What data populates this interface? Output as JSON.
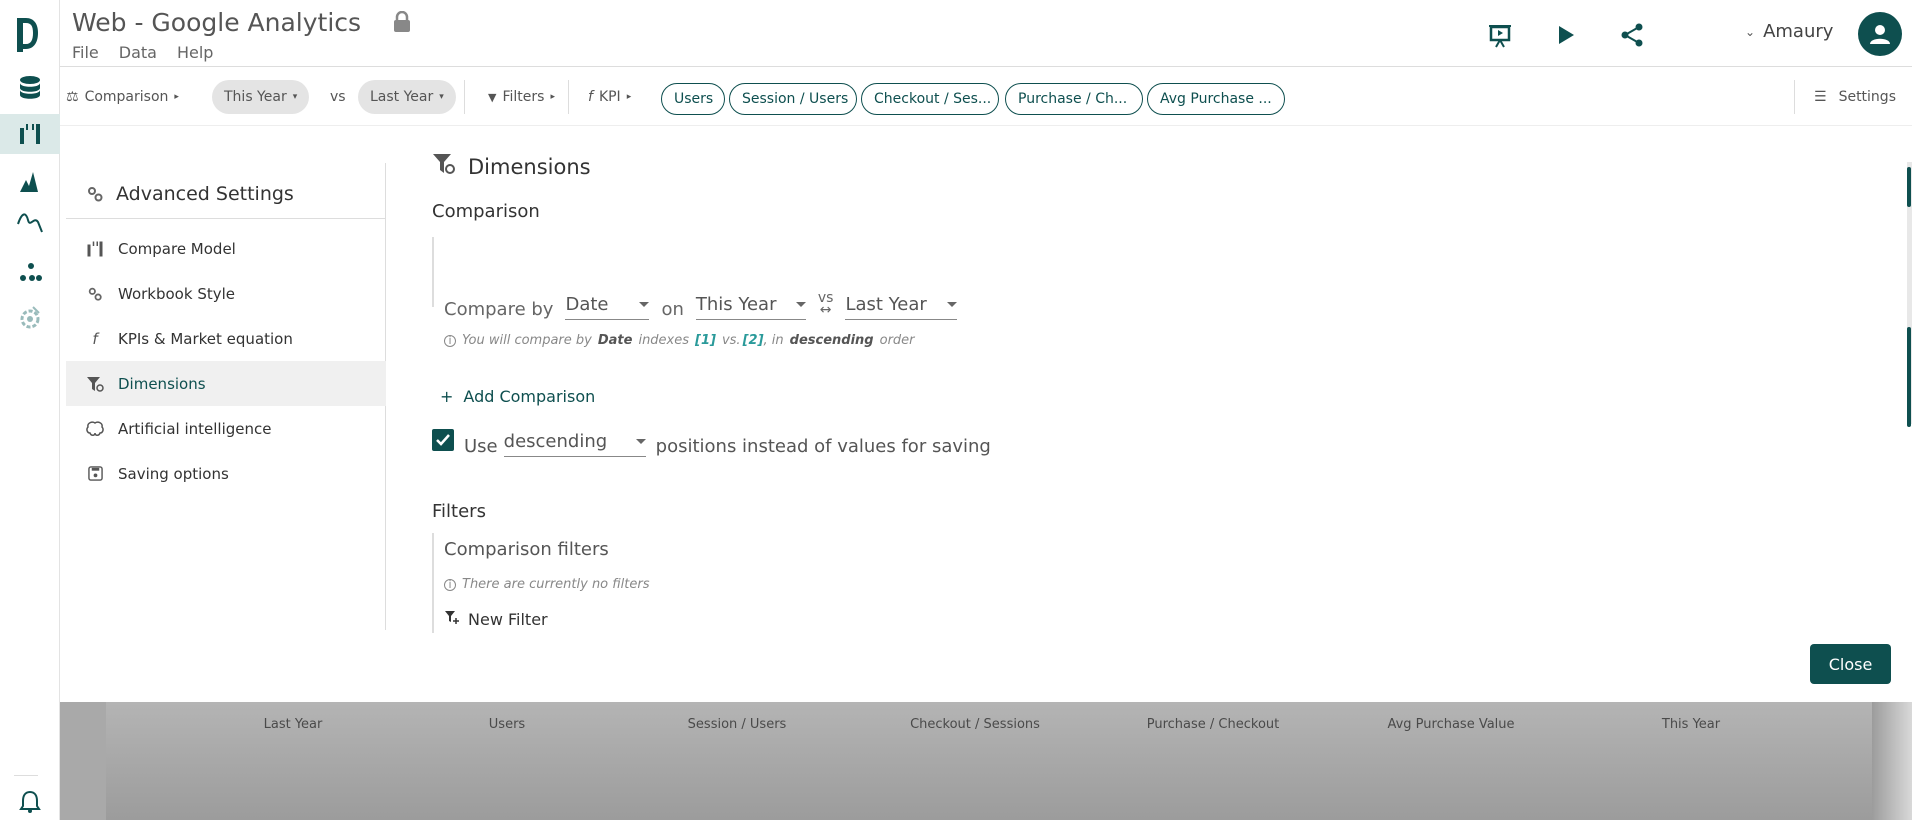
{
  "app": {
    "title": "Web - Google Analytics",
    "menu": [
      "File",
      "Data",
      "Help"
    ],
    "user_name": "Amaury"
  },
  "toolbar": {
    "comparison_label": "Comparison",
    "this_year": "This Year",
    "vs": "vs",
    "last_year": "Last Year",
    "filters_label": "Filters",
    "kpi_label": "KPI",
    "kpi_pills": [
      "Users",
      "Session / Users",
      "Checkout / Ses...",
      "Purchase / Ch...",
      "Avg Purchase ..."
    ],
    "settings_label": "Settings"
  },
  "sidebar": {
    "title": "Advanced Settings",
    "items": [
      {
        "label": "Compare Model",
        "icon": "compare-model-icon"
      },
      {
        "label": "Workbook Style",
        "icon": "gears-icon"
      },
      {
        "label": "KPIs & Market equation",
        "icon": "function-icon"
      },
      {
        "label": "Dimensions",
        "icon": "filter-gear-icon",
        "active": true
      },
      {
        "label": "Artificial intelligence",
        "icon": "brain-icon"
      },
      {
        "label": "Saving options",
        "icon": "save-icon"
      }
    ]
  },
  "dimensions": {
    "title": "Dimensions",
    "comparison_heading": "Comparison",
    "compare_by": "Compare by",
    "compare_by_value": "Date",
    "on": "on",
    "on_value": "This Year",
    "vs": "vs",
    "vs_value": "Last Year",
    "note_prefix": "You will compare by",
    "note_dim": "Date",
    "note_mid": "indexes",
    "note_idx1": "[1]",
    "note_vs": "vs.",
    "note_idx2": "[2]",
    "note_in": ", in",
    "note_order": "descending",
    "note_suffix": "order",
    "add_comparison": "Add Comparison",
    "use_label": "Use",
    "use_value": "descending",
    "use_suffix": "positions instead of values for saving",
    "filters_heading": "Filters",
    "comparison_filters": "Comparison filters",
    "no_filters": "There are currently no filters",
    "new_filter": "New Filter"
  },
  "close_label": "Close",
  "table_headers": [
    "Last Year",
    "Users",
    "Session / Users",
    "Checkout / Sessions",
    "Purchase / Checkout",
    "Avg Purchase Value",
    "This Year"
  ],
  "colors": {
    "accent": "#0e4f4f",
    "highlight": "#2a9a9a"
  }
}
